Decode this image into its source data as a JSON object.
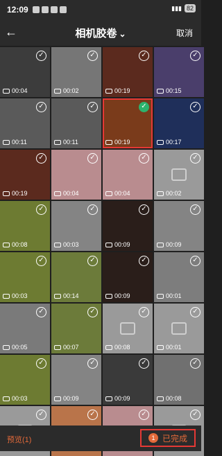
{
  "status_bar": {
    "time": "12:09",
    "battery": "82"
  },
  "header": {
    "title": "相机胶卷",
    "cancel_label": "取消"
  },
  "grid": {
    "items": [
      {
        "duration": "00:04",
        "type": "video",
        "color": "#3c3c3c"
      },
      {
        "duration": "00:02",
        "type": "video",
        "color": "#767676"
      },
      {
        "duration": "00:19",
        "type": "video",
        "color": "#5b2a1e"
      },
      {
        "duration": "00:15",
        "type": "video",
        "color": "#4a3e6b"
      },
      {
        "duration": "00:11",
        "type": "video",
        "color": "#5a5a5a"
      },
      {
        "duration": "00:11",
        "type": "video",
        "color": "#5a5a5a"
      },
      {
        "duration": "00:19",
        "type": "video",
        "color": "#7a3b1b",
        "selected": true
      },
      {
        "duration": "00:17",
        "type": "video",
        "color": "#1f2f5a"
      },
      {
        "duration": "00:19",
        "type": "video",
        "color": "#5b2a1e"
      },
      {
        "duration": "00:04",
        "type": "video",
        "color": "#b98c8f"
      },
      {
        "duration": "00:04",
        "type": "video",
        "color": "#b98c8f"
      },
      {
        "duration": "00:02",
        "type": "image",
        "color": "#9a9a9a"
      },
      {
        "duration": "00:08",
        "type": "video",
        "color": "#6d7b32"
      },
      {
        "duration": "00:03",
        "type": "video",
        "color": "#848484"
      },
      {
        "duration": "00:09",
        "type": "video",
        "color": "#2a1e1a"
      },
      {
        "duration": "00:09",
        "type": "video",
        "color": "#848484"
      },
      {
        "duration": "00:03",
        "type": "video",
        "color": "#6d7b32"
      },
      {
        "duration": "00:14",
        "type": "video",
        "color": "#6c7b3a"
      },
      {
        "duration": "00:09",
        "type": "video",
        "color": "#2a1e1a"
      },
      {
        "duration": "00:01",
        "type": "video",
        "color": "#7d7d7d"
      },
      {
        "duration": "00:05",
        "type": "video",
        "color": "#7a7a7a"
      },
      {
        "duration": "00:07",
        "type": "video",
        "color": "#6c7b3a"
      },
      {
        "duration": "00:08",
        "type": "image",
        "color": "#9a9a9a"
      },
      {
        "duration": "00:01",
        "type": "image",
        "color": "#9a9a9a"
      },
      {
        "duration": "00:03",
        "type": "video",
        "color": "#6d7b32"
      },
      {
        "duration": "00:09",
        "type": "video",
        "color": "#848484"
      },
      {
        "duration": "00:09",
        "type": "video",
        "color": "#3a3a3a"
      },
      {
        "duration": "00:08",
        "type": "video",
        "color": "#707070"
      },
      {
        "duration": "",
        "type": "image",
        "color": "#9a9a9a"
      },
      {
        "duration": "",
        "type": "video",
        "color": "#b9744a"
      },
      {
        "duration": "",
        "type": "video",
        "color": "#b98c8f"
      },
      {
        "duration": "",
        "type": "image",
        "color": "#9a9a9a"
      }
    ]
  },
  "footer": {
    "preview_label": "预览(1)",
    "done_count": "1",
    "done_label": "已完成"
  },
  "colors": {
    "accent": "#e46a3a",
    "check_selected": "#2db36d",
    "highlight": "#e53935"
  }
}
